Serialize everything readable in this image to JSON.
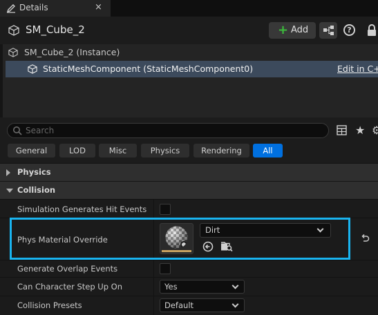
{
  "tab": {
    "label": "Details",
    "close": "×"
  },
  "header": {
    "object_name": "SM_Cube_2",
    "add_label": "Add",
    "help": "?"
  },
  "tree": {
    "instance_label": "SM_Cube_2 (Instance)",
    "component_label": "StaticMeshComponent (StaticMeshComponent0)",
    "edit_link": "Edit in C++"
  },
  "search": {
    "placeholder": "Search"
  },
  "filters": [
    "General",
    "LOD",
    "Misc",
    "Physics",
    "Rendering",
    "All"
  ],
  "active_filter": "All",
  "categories": {
    "physics": "Physics",
    "collision": "Collision"
  },
  "properties": {
    "sim_hit": {
      "label": "Simulation Generates Hit Events",
      "checked": false
    },
    "phys_material": {
      "label": "Phys Material Override",
      "value": "Dirt"
    },
    "overlap": {
      "label": "Generate Overlap Events",
      "checked": false
    },
    "step_up": {
      "label": "Can Character Step Up On",
      "value": "Yes"
    },
    "presets": {
      "label": "Collision Presets",
      "value": "Default"
    }
  },
  "colors": {
    "accent": "#0070e0",
    "highlight": "#19b4f0",
    "add_plus": "#3cbf3c",
    "selected_row": "#3c4a5c"
  },
  "icons": [
    "edit-pencil-icon",
    "close-icon",
    "static-mesh-icon",
    "plus-icon",
    "blueprint-icon",
    "help-icon",
    "lock-icon",
    "search-icon",
    "table-icon",
    "star-icon",
    "gear-icon",
    "use-selected-icon",
    "browse-icon",
    "reset-icon"
  ]
}
